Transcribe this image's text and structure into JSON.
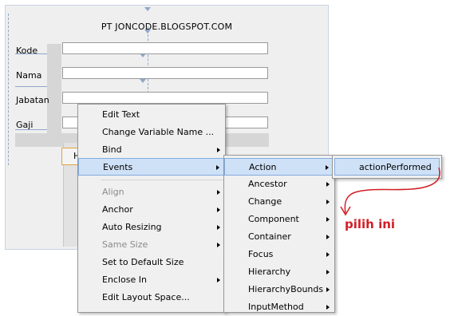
{
  "form": {
    "title": "PT JONCODE.BLOGSPOT.COM",
    "labels": [
      "Kode",
      "Nama",
      "Jabatan",
      "Gaji"
    ],
    "partial_button_text": "H"
  },
  "context_menu": {
    "items": [
      {
        "label": "Edit Text",
        "disabled": false,
        "submenu": false
      },
      {
        "label": "Change Variable Name ...",
        "disabled": false,
        "submenu": false
      },
      {
        "label": "Bind",
        "disabled": false,
        "submenu": true
      },
      {
        "label": "Events",
        "disabled": false,
        "submenu": true,
        "selected": true
      },
      {
        "label": "Align",
        "disabled": true,
        "submenu": true
      },
      {
        "label": "Anchor",
        "disabled": false,
        "submenu": true
      },
      {
        "label": "Auto Resizing",
        "disabled": false,
        "submenu": true
      },
      {
        "label": "Same Size",
        "disabled": true,
        "submenu": true
      },
      {
        "label": "Set to Default Size",
        "disabled": false,
        "submenu": false
      },
      {
        "label": "Enclose In",
        "disabled": false,
        "submenu": true
      },
      {
        "label": "Edit Layout Space...",
        "disabled": false,
        "submenu": false
      }
    ]
  },
  "events_menu": {
    "items": [
      {
        "label": "Action",
        "selected": true
      },
      {
        "label": "Ancestor"
      },
      {
        "label": "Change"
      },
      {
        "label": "Component"
      },
      {
        "label": "Container"
      },
      {
        "label": "Focus"
      },
      {
        "label": "Hierarchy"
      },
      {
        "label": "HierarchyBounds"
      },
      {
        "label": "InputMethod"
      }
    ]
  },
  "action_menu": {
    "items": [
      {
        "label": "actionPerformed",
        "selected": true
      }
    ]
  },
  "annotation": {
    "text": "pilih ini",
    "color": "#d21f26"
  }
}
